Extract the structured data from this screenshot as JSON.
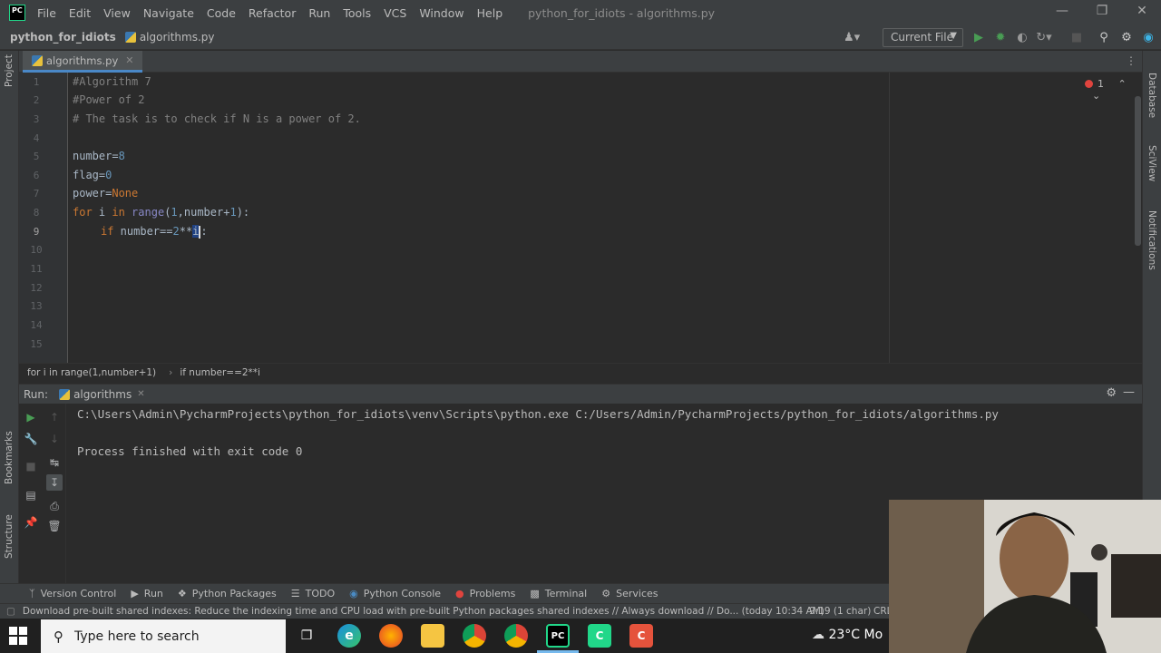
{
  "app": {
    "logo_text": "PC",
    "window_title": "python_for_idiots - algorithms.py",
    "menu": [
      "File",
      "Edit",
      "View",
      "Navigate",
      "Code",
      "Refactor",
      "Run",
      "Tools",
      "VCS",
      "Window",
      "Help"
    ]
  },
  "navbar": {
    "project": "python_for_idiots",
    "file": "algorithms.py",
    "run_config": "Current File"
  },
  "left_strip": {
    "project": "Project",
    "bookmarks": "Bookmarks",
    "structure": "Structure"
  },
  "right_strip": {
    "database": "Database",
    "sciview": "SciView",
    "notifications": "Notifications"
  },
  "editor": {
    "tab": "algorithms.py",
    "error_count": "1",
    "line_numbers": [
      "1",
      "2",
      "3",
      "4",
      "5",
      "6",
      "7",
      "8",
      "9",
      "10",
      "11",
      "12",
      "13",
      "14",
      "15"
    ],
    "lines": {
      "l1": "#Algorithm 7",
      "l2": "#Power of 2",
      "l3": "# The task is to check if N is a power of 2.",
      "l5a": "number=",
      "l5b": "8",
      "l6a": "flag=",
      "l6b": "0",
      "l7a": "power=",
      "l7b": "None",
      "l8_for": "for",
      "l8_i": " i ",
      "l8_in": "in",
      "l8_range": " range",
      "l8_open": "(",
      "l8_one": "1",
      "l8_rest": ",number+",
      "l8_one2": "1",
      "l8_close": "):",
      "l9_if": "if",
      "l9_cond": " number==",
      "l9_two": "2",
      "l9_pow": "**",
      "l9_i": "i",
      "l9_colon": ":"
    }
  },
  "breadcrumbs": {
    "first": "for i in range(1,number+1)",
    "second": "if number==2**i"
  },
  "run": {
    "label": "Run:",
    "tab": "algorithms",
    "command": "C:\\Users\\Admin\\PycharmProjects\\python_for_idiots\\venv\\Scripts\\python.exe C:/Users/Admin/PycharmProjects/python_for_idiots/algorithms.py",
    "result": "Process finished with exit code 0"
  },
  "tool_tabs": [
    "Version Control",
    "Run",
    "Python Packages",
    "TODO",
    "Python Console",
    "Problems",
    "Terminal",
    "Services"
  ],
  "status": {
    "message": "Download pre-built shared indexes: Reduce the indexing time and CPU load with pre-built Python packages shared indexes // Always download // Do... (today 10:34 AM)",
    "position": "9:19 (1 char)",
    "crlf": "CRL"
  },
  "taskbar": {
    "search_placeholder": "Type here to search",
    "weather": "23°C",
    "weather_extra": "Mo"
  }
}
